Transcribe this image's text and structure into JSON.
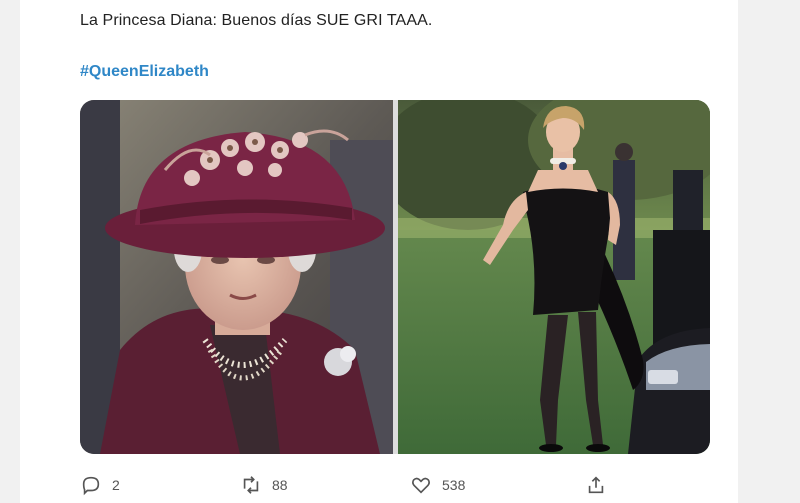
{
  "tweet": {
    "text": "La Princesa Diana: Buenos días SUE GRI TAAA.",
    "hashtag": "#QueenElizabeth"
  },
  "actions": {
    "reply_count": "2",
    "retweet_count": "88",
    "like_count": "538"
  },
  "icons": {
    "reply": "reply-icon",
    "retweet": "retweet-icon",
    "like": "like-icon",
    "share": "share-icon"
  },
  "colors": {
    "hashtag": "#2f87c7",
    "text": "#222222",
    "icon": "#555555"
  }
}
